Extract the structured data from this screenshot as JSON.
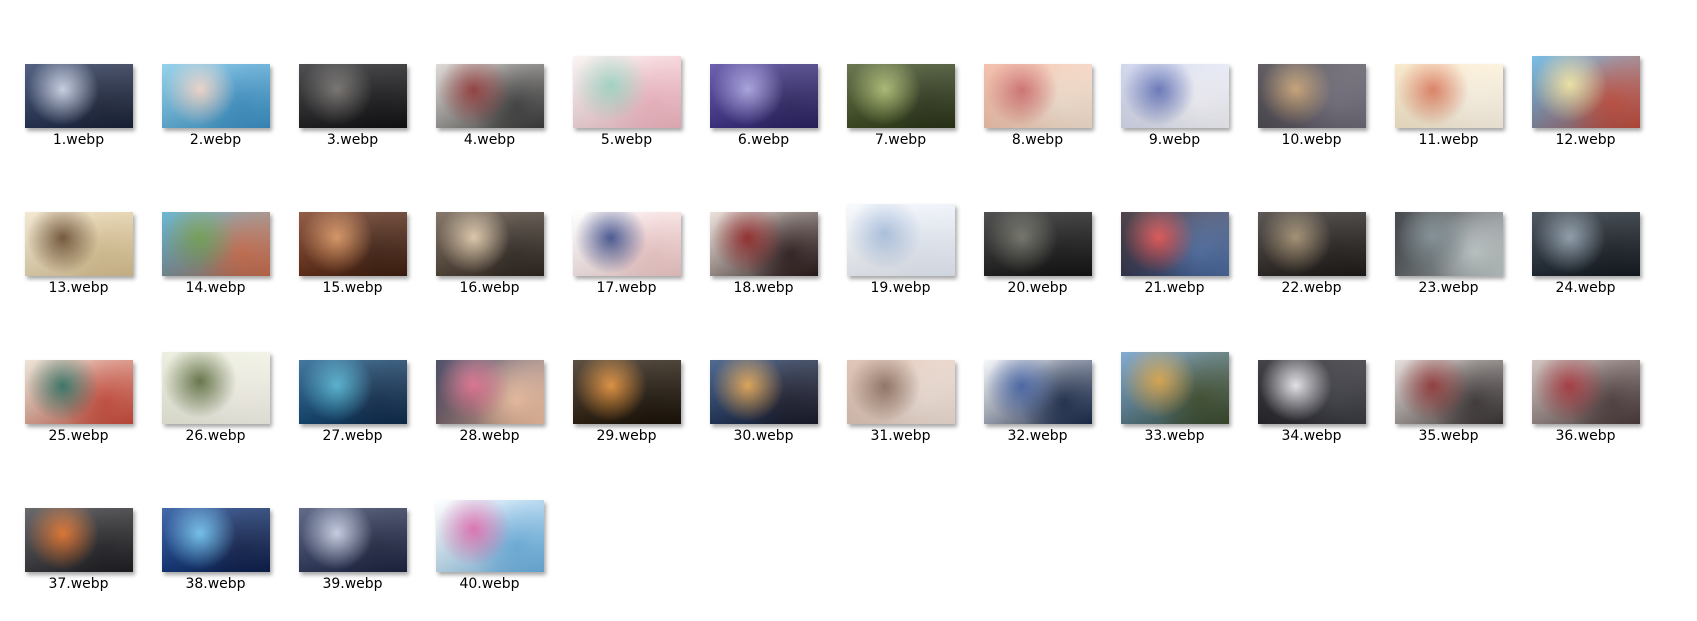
{
  "files": [
    {
      "name": "1.webp",
      "icon": "image-thumbnail-icon",
      "colors": [
        "#2e3f66",
        "#c9d2e6",
        "#1a2238"
      ]
    },
    {
      "name": "2.webp",
      "icon": "image-thumbnail-icon",
      "colors": [
        "#7ec8e8",
        "#f2d6c8",
        "#3a8fc4"
      ]
    },
    {
      "name": "3.webp",
      "icon": "image-thumbnail-icon",
      "colors": [
        "#2a2a2e",
        "#6e6a66",
        "#121214"
      ]
    },
    {
      "name": "4.webp",
      "icon": "image-thumbnail-icon",
      "colors": [
        "#d8d4cf",
        "#8c2f2f",
        "#3b3b3b"
      ]
    },
    {
      "name": "5.webp",
      "icon": "image-thumbnail-icon",
      "colors": [
        "#f7f2f0",
        "#9fd6c4",
        "#f2b6c2"
      ]
    },
    {
      "name": "6.webp",
      "icon": "image-thumbnail-icon",
      "colors": [
        "#4e3fa0",
        "#a6a0e0",
        "#2a2260"
      ]
    },
    {
      "name": "7.webp",
      "icon": "image-thumbnail-icon",
      "colors": [
        "#4a5a2a",
        "#a8b86a",
        "#2a3418"
      ]
    },
    {
      "name": "8.webp",
      "icon": "image-thumbnail-icon",
      "colors": [
        "#f1b39a",
        "#d06a6a",
        "#f6e2d0"
      ]
    },
    {
      "name": "9.webp",
      "icon": "image-thumbnail-icon",
      "colors": [
        "#c8cfe8",
        "#5e6fb8",
        "#f4f4fa"
      ]
    },
    {
      "name": "10.webp",
      "icon": "image-thumbnail-icon",
      "colors": [
        "#3e3a40",
        "#c8a070",
        "#6e6a78"
      ]
    },
    {
      "name": "11.webp",
      "icon": "image-thumbnail-icon",
      "colors": [
        "#f6e4c0",
        "#e07a5a",
        "#fff6e6"
      ]
    },
    {
      "name": "12.webp",
      "icon": "image-thumbnail-icon",
      "colors": [
        "#5ab0e0",
        "#f4e6a0",
        "#c04a3a"
      ]
    },
    {
      "name": "13.webp",
      "icon": "image-thumbnail-icon",
      "colors": [
        "#f0e4c8",
        "#6a4a2a",
        "#d8c090"
      ]
    },
    {
      "name": "14.webp",
      "icon": "image-thumbnail-icon",
      "colors": [
        "#4aa8c8",
        "#6a9a4a",
        "#c86a4a"
      ]
    },
    {
      "name": "15.webp",
      "icon": "image-thumbnail-icon",
      "colors": [
        "#7a3a20",
        "#d8905a",
        "#3e1e10"
      ]
    },
    {
      "name": "16.webp",
      "icon": "image-thumbnail-icon",
      "colors": [
        "#6a5a4a",
        "#e0c8a8",
        "#2e2620"
      ]
    },
    {
      "name": "17.webp",
      "icon": "image-thumbnail-icon",
      "colors": [
        "#ffffff",
        "#3a4a8a",
        "#f0c8c8"
      ]
    },
    {
      "name": "18.webp",
      "icon": "image-thumbnail-icon",
      "colors": [
        "#e8dcd4",
        "#8a1a1a",
        "#2a1a1a"
      ]
    },
    {
      "name": "19.webp",
      "icon": "image-thumbnail-icon",
      "colors": [
        "#f6f8fc",
        "#a8c0e0",
        "#e6ecf6"
      ]
    },
    {
      "name": "20.webp",
      "icon": "image-thumbnail-icon",
      "colors": [
        "#2a2a2a",
        "#6a6a60",
        "#141414"
      ]
    },
    {
      "name": "21.webp",
      "icon": "image-thumbnail-icon",
      "colors": [
        "#2a1a20",
        "#e04a4a",
        "#4a6aa0"
      ]
    },
    {
      "name": "22.webp",
      "icon": "image-thumbnail-icon",
      "colors": [
        "#3a3430",
        "#a08a6a",
        "#1e1a18"
      ]
    },
    {
      "name": "23.webp",
      "icon": "image-thumbnail-icon",
      "colors": [
        "#1e2228",
        "#7a8a90",
        "#c0c8c8"
      ]
    },
    {
      "name": "24.webp",
      "icon": "image-thumbnail-icon",
      "colors": [
        "#2a3440",
        "#8a9aa8",
        "#141a20"
      ]
    },
    {
      "name": "25.webp",
      "icon": "image-thumbnail-icon",
      "colors": [
        "#e8e0d0",
        "#2a6a5a",
        "#c84a3a"
      ]
    },
    {
      "name": "26.webp",
      "icon": "image-thumbnail-icon",
      "colors": [
        "#e8ecd8",
        "#5a6a3a",
        "#f6f4ea"
      ]
    },
    {
      "name": "27.webp",
      "icon": "image-thumbnail-icon",
      "colors": [
        "#1a5a8a",
        "#4ab0d0",
        "#0e2a4a"
      ]
    },
    {
      "name": "28.webp",
      "icon": "image-thumbnail-icon",
      "colors": [
        "#2a2a4a",
        "#e06a8a",
        "#f0c0a0"
      ]
    },
    {
      "name": "29.webp",
      "icon": "image-thumbnail-icon",
      "colors": [
        "#3a2a18",
        "#e08a30",
        "#1a1208"
      ]
    },
    {
      "name": "30.webp",
      "icon": "image-thumbnail-icon",
      "colors": [
        "#2a4a7a",
        "#e0a04a",
        "#1a1a2a"
      ]
    },
    {
      "name": "31.webp",
      "icon": "image-thumbnail-icon",
      "colors": [
        "#d8b8a8",
        "#8a6a5a",
        "#f0e0d6"
      ]
    },
    {
      "name": "32.webp",
      "icon": "image-thumbnail-icon",
      "colors": [
        "#f4f6fa",
        "#3a5aa0",
        "#1a2a4a"
      ]
    },
    {
      "name": "33.webp",
      "icon": "image-thumbnail-icon",
      "colors": [
        "#6a9ac8",
        "#d8a040",
        "#3a4a2a"
      ]
    },
    {
      "name": "34.webp",
      "icon": "image-thumbnail-icon",
      "colors": [
        "#1a1a1e",
        "#e8e8ee",
        "#3a3a42"
      ]
    },
    {
      "name": "35.webp",
      "icon": "image-thumbnail-icon",
      "colors": [
        "#e0d8d4",
        "#8a2a2a",
        "#3a3434"
      ]
    },
    {
      "name": "36.webp",
      "icon": "image-thumbnail-icon",
      "colors": [
        "#c8b8b4",
        "#a02a30",
        "#4a3a3a"
      ]
    },
    {
      "name": "37.webp",
      "icon": "image-thumbnail-icon",
      "colors": [
        "#4a4a4e",
        "#e06a20",
        "#1e1e22"
      ]
    },
    {
      "name": "38.webp",
      "icon": "image-thumbnail-icon",
      "colors": [
        "#1a4a9a",
        "#6ac0f0",
        "#0e1e4a"
      ]
    },
    {
      "name": "39.webp",
      "icon": "image-thumbnail-icon",
      "colors": [
        "#3e4a70",
        "#c8d0e6",
        "#1e2440"
      ]
    },
    {
      "name": "40.webp",
      "icon": "image-thumbnail-icon",
      "colors": [
        "#ffffff",
        "#e06ab0",
        "#6ab0e0"
      ]
    }
  ]
}
